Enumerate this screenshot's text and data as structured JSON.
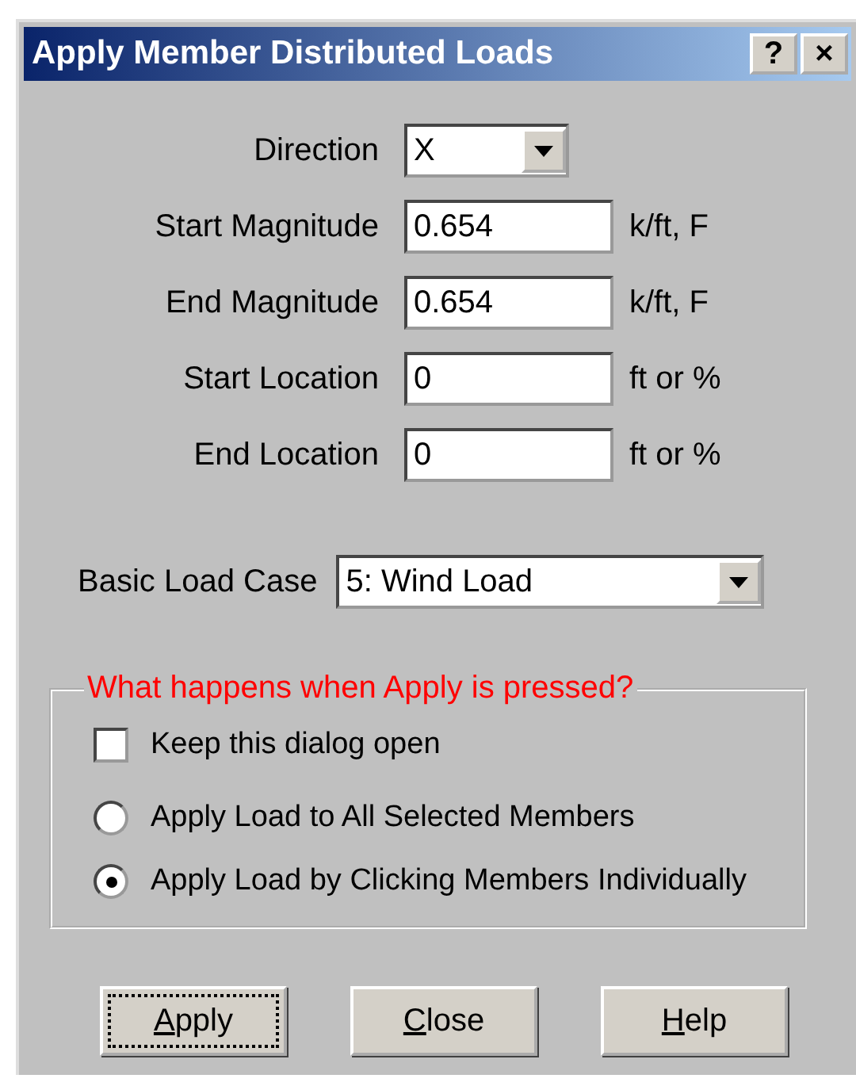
{
  "window": {
    "title": "Apply Member Distributed Loads",
    "title_buttons": [
      "?",
      "×"
    ]
  },
  "fields": [
    {
      "label": "Direction",
      "kind": "combo",
      "value": "X"
    },
    {
      "label": "Start Magnitude",
      "kind": "text",
      "value": "0.654",
      "unit": "k/ft, F"
    },
    {
      "label": "End Magnitude",
      "kind": "text",
      "value": "0.654",
      "unit": "k/ft, F"
    },
    {
      "label": "Start Location",
      "kind": "text",
      "value": "0",
      "unit": "ft or %"
    },
    {
      "label": "End Location",
      "kind": "text",
      "value": "0",
      "unit": "ft or %"
    }
  ],
  "load_case": {
    "label": "Basic Load Case",
    "value": "5: Wind Load"
  },
  "group": {
    "title": "What happens when Apply is pressed?",
    "checkbox": {
      "label": "Keep this dialog open",
      "checked": false
    },
    "radios": [
      {
        "label": "Apply Load to All Selected Members",
        "selected": false
      },
      {
        "label": "Apply Load by Clicking Members Individually",
        "selected": true
      }
    ]
  },
  "buttons": [
    {
      "label": "Apply",
      "default": true,
      "underline_first": true
    },
    {
      "label": "Close",
      "default": false,
      "underline_first": true
    },
    {
      "label": "Help",
      "default": false,
      "underline_first": true
    }
  ]
}
